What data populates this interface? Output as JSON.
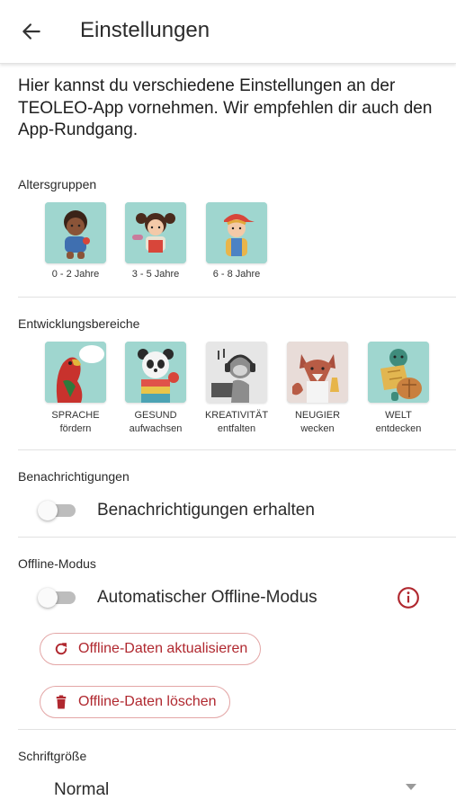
{
  "appbar": {
    "title": "Einstellungen"
  },
  "intro": {
    "text": "Hier kannst du verschiedene Einstellungen an der TEOLEO-App vornehmen. Wir empfehlen dir auch den App-Rundgang."
  },
  "age_groups": {
    "label": "Altersgruppen",
    "items": [
      {
        "label": "0 - 2 Jahre",
        "icon": "toddler-illustration"
      },
      {
        "label": "3 - 5 Jahre",
        "icon": "girl-illustration"
      },
      {
        "label": "6 - 8 Jahre",
        "icon": "boy-cap-illustration"
      }
    ]
  },
  "dev_areas": {
    "label": "Entwicklungsbereiche",
    "items": [
      {
        "line1": "SPRACHE",
        "line2": "fördern",
        "icon": "parrot-illustration"
      },
      {
        "line1": "GESUND",
        "line2": "aufwachsen",
        "icon": "panda-illustration"
      },
      {
        "line1": "KREATIVITÄT",
        "line2": "entfalten",
        "icon": "monkey-headphones-illustration"
      },
      {
        "line1": "NEUGIER",
        "line2": "wecken",
        "icon": "fox-scientist-illustration"
      },
      {
        "line1": "WELT",
        "line2": "entdecken",
        "icon": "turtle-map-illustration"
      }
    ]
  },
  "notifications": {
    "label": "Benachrichtigungen",
    "toggle_label": "Benachrichtigungen erhalten",
    "enabled": false
  },
  "offline": {
    "label": "Offline-Modus",
    "toggle_label": "Automatischer Offline-Modus",
    "enabled": false,
    "info_icon": "info-circle-icon",
    "refresh_label": "Offline-Daten aktualisieren",
    "delete_label": "Offline-Daten löschen"
  },
  "font_size": {
    "label": "Schriftgröße",
    "value": "Normal"
  },
  "colors": {
    "accent": "#b0282f",
    "pill_border": "#e3a6a6",
    "tile_bg": "#9fd6cf",
    "switch_off": "#bdbdbd"
  }
}
